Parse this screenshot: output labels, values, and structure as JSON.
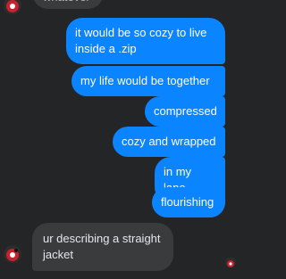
{
  "conversation": {
    "previous_incoming_partial": "whatever",
    "outgoing": [
      {
        "text": "it would be so cozy to live inside a .zip"
      },
      {
        "text": "my life would be together"
      },
      {
        "text": "compressed"
      },
      {
        "text": "cozy and wrapped"
      },
      {
        "text": "in my lane"
      },
      {
        "text": "flourishing"
      }
    ],
    "incoming_reply": "ur describing a straight jacket"
  },
  "colors": {
    "background": "#242526",
    "outgoing_bubble": "#0a84ff",
    "incoming_bubble": "#3a3b3c",
    "avatar_primary": "#c8202e"
  },
  "icons": {
    "sender_avatar": "avatar-icon",
    "seen_receipt": "seen-avatar-icon"
  }
}
